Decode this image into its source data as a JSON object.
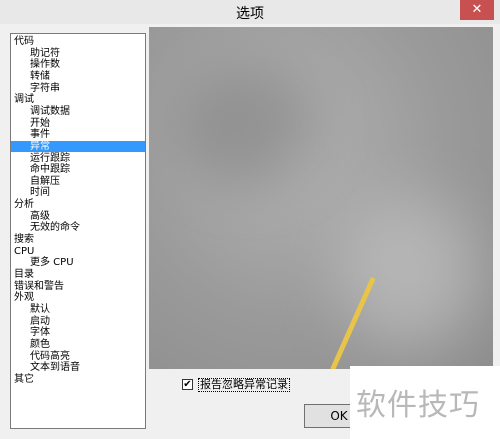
{
  "window": {
    "title": "选项",
    "close_glyph": "✕"
  },
  "tree": {
    "items": [
      {
        "label": "代码",
        "level": 0
      },
      {
        "label": "助记符",
        "level": 1
      },
      {
        "label": "操作数",
        "level": 1
      },
      {
        "label": "转储",
        "level": 1
      },
      {
        "label": "字符串",
        "level": 1
      },
      {
        "label": "调试",
        "level": 0
      },
      {
        "label": "调试数据",
        "level": 1
      },
      {
        "label": "开始",
        "level": 1
      },
      {
        "label": "事件",
        "level": 1
      },
      {
        "label": "异常",
        "level": 1,
        "selected": true
      },
      {
        "label": "运行跟踪",
        "level": 1
      },
      {
        "label": "命中跟踪",
        "level": 1
      },
      {
        "label": "自解压",
        "level": 1
      },
      {
        "label": "时间",
        "level": 1
      },
      {
        "label": "分析",
        "level": 0
      },
      {
        "label": "高级",
        "level": 1
      },
      {
        "label": "无效的命令",
        "level": 1
      },
      {
        "label": "搜索",
        "level": 0
      },
      {
        "label": "CPU",
        "level": 0
      },
      {
        "label": "更多 CPU",
        "level": 1
      },
      {
        "label": "目录",
        "level": 0
      },
      {
        "label": "错误和警告",
        "level": 0
      },
      {
        "label": "外观",
        "level": 0
      },
      {
        "label": "默认",
        "level": 1
      },
      {
        "label": "启动",
        "level": 1
      },
      {
        "label": "字体",
        "level": 1
      },
      {
        "label": "颜色",
        "level": 1
      },
      {
        "label": "代码高亮",
        "level": 1
      },
      {
        "label": "文本到语音",
        "level": 1
      },
      {
        "label": "其它",
        "level": 0
      }
    ]
  },
  "options": {
    "checkbox_label": "报告忽略异常记录",
    "checkbox_checked": true,
    "check_glyph": "✔"
  },
  "buttons": {
    "ok_label": "OK"
  },
  "watermark": {
    "text": "软件技巧"
  },
  "colors": {
    "selection": "#3399ff",
    "close_button": "#c75050",
    "pencil": "#e8c44a"
  }
}
